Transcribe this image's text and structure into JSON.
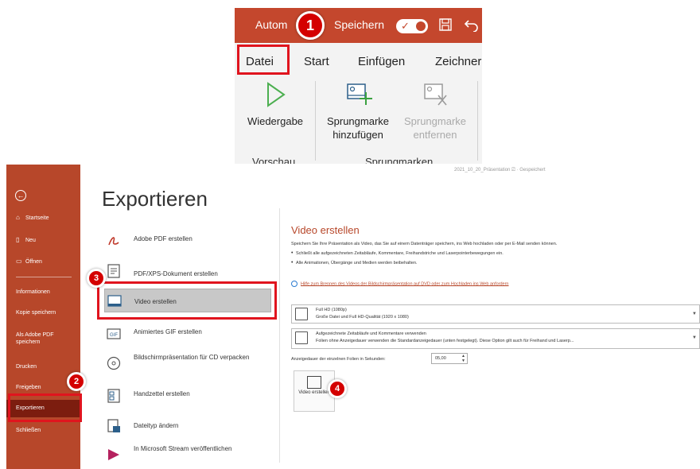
{
  "ribbon": {
    "autosave_label": "Autom",
    "save_label": "Speichern",
    "toggle_check": "✓",
    "tabs": [
      "Datei",
      "Start",
      "Einfügen",
      "Zeichner"
    ],
    "buttons": {
      "play": "Wiedergabe",
      "add_bookmark_line1": "Sprungmarke",
      "add_bookmark_line2": "hinzufügen",
      "remove_bookmark_line1": "Sprungmarke",
      "remove_bookmark_line2": "entfernen"
    },
    "groups": {
      "preview": "Vorschau",
      "bookmarks": "Sprungmarken"
    }
  },
  "markers": {
    "m1": "1",
    "m2": "2",
    "m3": "3",
    "m4": "4"
  },
  "window_title": "2021_10_20_Präsentation  ⎚  ·  Gespeichert",
  "sidebar": {
    "back_icon": "←",
    "items": [
      {
        "icon": "home-icon",
        "label": "Startseite"
      },
      {
        "icon": "new-icon",
        "label": "Neu"
      },
      {
        "icon": "open-icon",
        "label": "Öffnen"
      },
      {
        "icon": "",
        "label": "Informationen"
      },
      {
        "icon": "",
        "label": "Kopie speichern"
      },
      {
        "icon": "",
        "label": "Als Adobe PDF speichern"
      },
      {
        "icon": "",
        "label": "Drucken"
      },
      {
        "icon": "",
        "label": "Freigeben"
      },
      {
        "icon": "",
        "label": "Exportieren"
      },
      {
        "icon": "",
        "label": "Schließen"
      }
    ]
  },
  "main": {
    "title": "Exportieren",
    "export_options": [
      {
        "label": "Adobe PDF erstellen"
      },
      {
        "label": "PDF/XPS-Dokument erstellen"
      },
      {
        "label": "Video erstellen"
      },
      {
        "label": "Animiertes GIF erstellen"
      },
      {
        "label": "Bildschirmpräsentation für CD verpacken"
      },
      {
        "label": "Handzettel erstellen"
      },
      {
        "label": "Dateityp ändern"
      },
      {
        "label": "In Microsoft Stream veröffentlichen"
      }
    ]
  },
  "video": {
    "heading": "Video erstellen",
    "description": "Speichern Sie Ihre Präsentation als Video, das Sie auf einem Datenträger speichern, ins Web hochladen oder per E-Mail senden können.",
    "bullets": [
      "Schließt alle aufgezeichneten Zeitabläufe, Kommentare, Freihandstriche und Laserpointerbewegungen ein.",
      "Alle Animationen, Übergänge und Medien werden beibehalten."
    ],
    "help_link": "Hilfe zum Brennen des Videos der Bildschirmpräsentation auf DVD oder zum Hochladen ins Web anfordern",
    "quality": {
      "title": "Full HD (1080p)",
      "subtitle": "Große Datei und Full HD-Qualität (1920 x 1080)"
    },
    "timings": {
      "title": "Aufgezeichnete Zeitabläufe und Kommentare verwenden",
      "subtitle": "Folien ohne Anzeigedauer verwenden die Standardanzeigedauer (unten festgelegt). Diese Option gilt auch für Freihand und Laserp..."
    },
    "seconds_label": "Anzeigedauer der einzelnen Folien in Sekunden:",
    "seconds_value": "05,00",
    "create_button": "Video erstellen"
  },
  "colors": {
    "accent": "#b7472a",
    "sidebar_active": "#7c1d0f",
    "marker": "#d40000"
  }
}
